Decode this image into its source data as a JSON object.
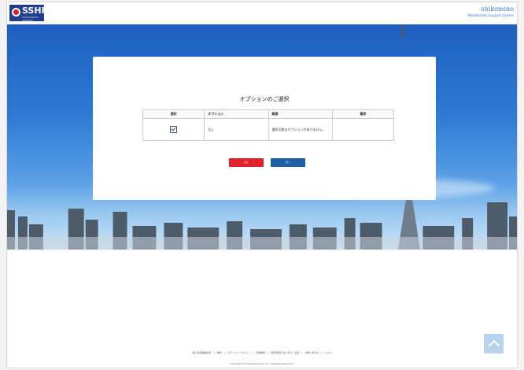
{
  "header": {
    "logo_text": "SSHP",
    "logo_sub": "SHIKOMINOMI SUPPORT",
    "brand_name": "shikomino",
    "brand_sub": "Membership Support System"
  },
  "card": {
    "title": "オプションのご選択",
    "table": {
      "columns": [
        "選択",
        "オプション",
        "概要",
        "備考"
      ],
      "rows": [
        {
          "selected": true,
          "option": "なし",
          "summary": "選択可能なオプションがありません。",
          "note": ""
        }
      ]
    },
    "back_label": "戻る",
    "next_label": "次へ"
  },
  "footer": {
    "links": [
      "個人情報保護方針",
      "規約",
      "プライバシーポリシー",
      "利用規約",
      "特定商取引法に基づく表記",
      "お問い合わせ",
      "ヘルプ"
    ],
    "separator": "|",
    "copyright": "Copyright © 2022 Shikomino Inc. All Rights Reserved."
  },
  "colors": {
    "back_button": "#e0202a",
    "next_button": "#1d5fa5",
    "sky": "#2f79d4"
  },
  "icons": {
    "logo": "sshp-logo-icon",
    "to_top": "chevron-up-icon"
  }
}
